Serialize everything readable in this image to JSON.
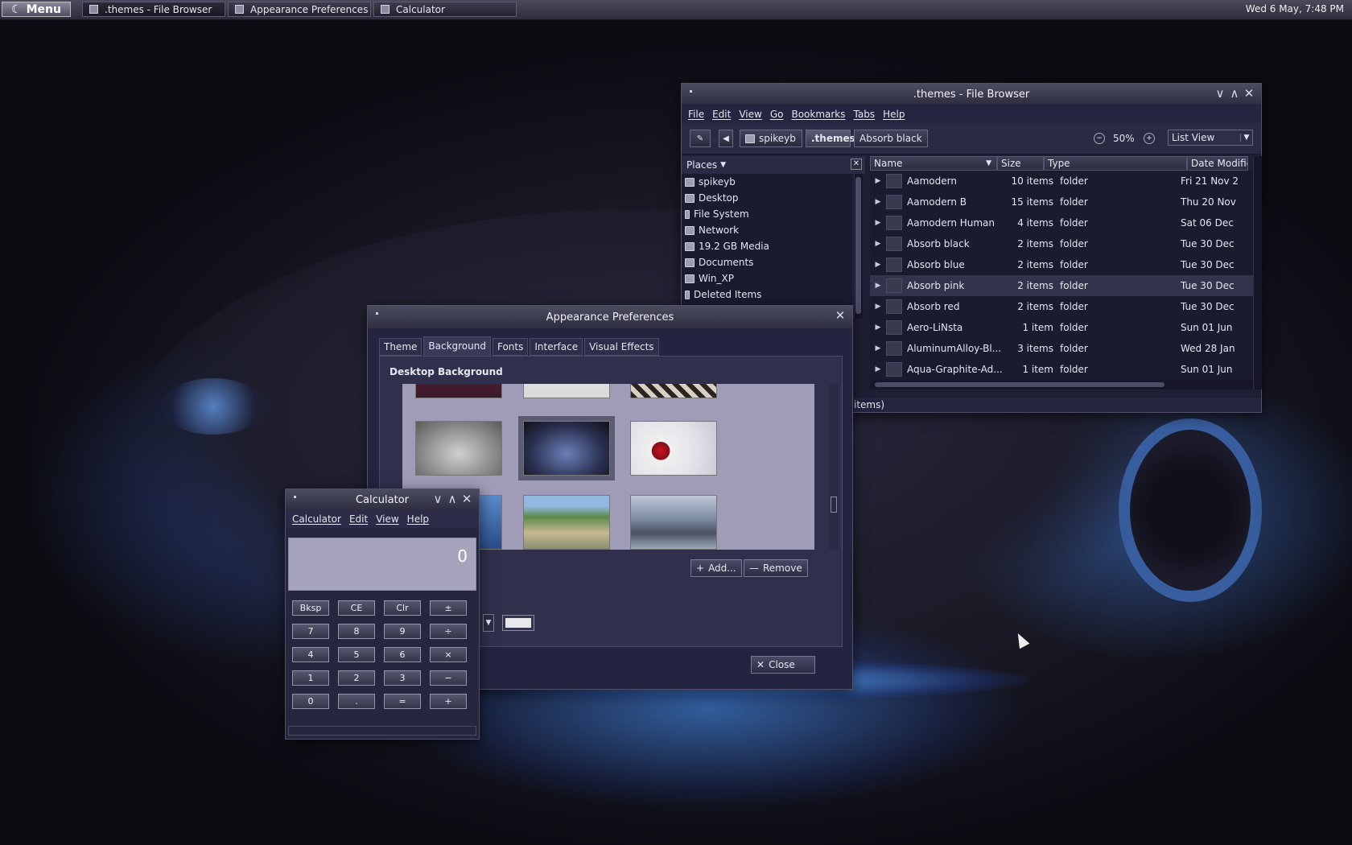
{
  "panel": {
    "menu_label": "Menu",
    "tasks": [
      {
        "label": ".themes - File Browser"
      },
      {
        "label": "Appearance Preferences"
      },
      {
        "label": "Calculator"
      }
    ],
    "clock": "Wed  6 May,  7:48 PM"
  },
  "file_browser": {
    "title": ".themes - File Browser",
    "menu": [
      "File",
      "Edit",
      "View",
      "Go",
      "Bookmarks",
      "Tabs",
      "Help"
    ],
    "path": [
      "spikeyb",
      ".themes",
      "Absorb black"
    ],
    "zoom": "50%",
    "view_mode": "List View",
    "places_label": "Places",
    "places": [
      "spikeyb",
      "Desktop",
      "File System",
      "Network",
      "19.2 GB Media",
      "Documents",
      "Win_XP",
      "Deleted Items"
    ],
    "columns": [
      "Name",
      "Size",
      "Type",
      "Date Modifie"
    ],
    "rows": [
      {
        "name": "Aamodern",
        "size": "10 items",
        "type": "folder",
        "date": "Fri 21 Nov 2"
      },
      {
        "name": "Aamodern B",
        "size": "15 items",
        "type": "folder",
        "date": "Thu 20 Nov"
      },
      {
        "name": "Aamodern Human",
        "size": "4 items",
        "type": "folder",
        "date": "Sat 06 Dec"
      },
      {
        "name": "Absorb black",
        "size": "2 items",
        "type": "folder",
        "date": "Tue 30 Dec"
      },
      {
        "name": "Absorb blue",
        "size": "2 items",
        "type": "folder",
        "date": "Tue 30 Dec"
      },
      {
        "name": "Absorb pink",
        "size": "2 items",
        "type": "folder",
        "date": "Tue 30 Dec"
      },
      {
        "name": "Absorb red",
        "size": "2 items",
        "type": "folder",
        "date": "Tue 30 Dec"
      },
      {
        "name": "Aero-LiNsta",
        "size": "1 item",
        "type": "folder",
        "date": "Sun 01 Jun"
      },
      {
        "name": "AluminumAlloy-Bl...",
        "size": "3 items",
        "type": "folder",
        "date": "Wed 28 Jan"
      },
      {
        "name": "Aqua-Graphite-Ad...",
        "size": "1 item",
        "type": "folder",
        "date": "Sun 01 Jun"
      }
    ],
    "status": "items)"
  },
  "appearance": {
    "title": "Appearance Preferences",
    "tabs": [
      "Theme",
      "Background",
      "Fonts",
      "Interface",
      "Visual Effects"
    ],
    "section_title": "Desktop Background",
    "add_label": "Add...",
    "remove_label": "Remove",
    "close_label": "Close"
  },
  "calculator": {
    "title": "Calculator",
    "menu": [
      "Calculator",
      "Edit",
      "View",
      "Help"
    ],
    "display": "0",
    "keys": [
      "Bksp",
      "CE",
      "Clr",
      "±",
      "7",
      "8",
      "9",
      "÷",
      "4",
      "5",
      "6",
      "×",
      "1",
      "2",
      "3",
      "−",
      "0",
      ".",
      "=",
      "+"
    ]
  }
}
